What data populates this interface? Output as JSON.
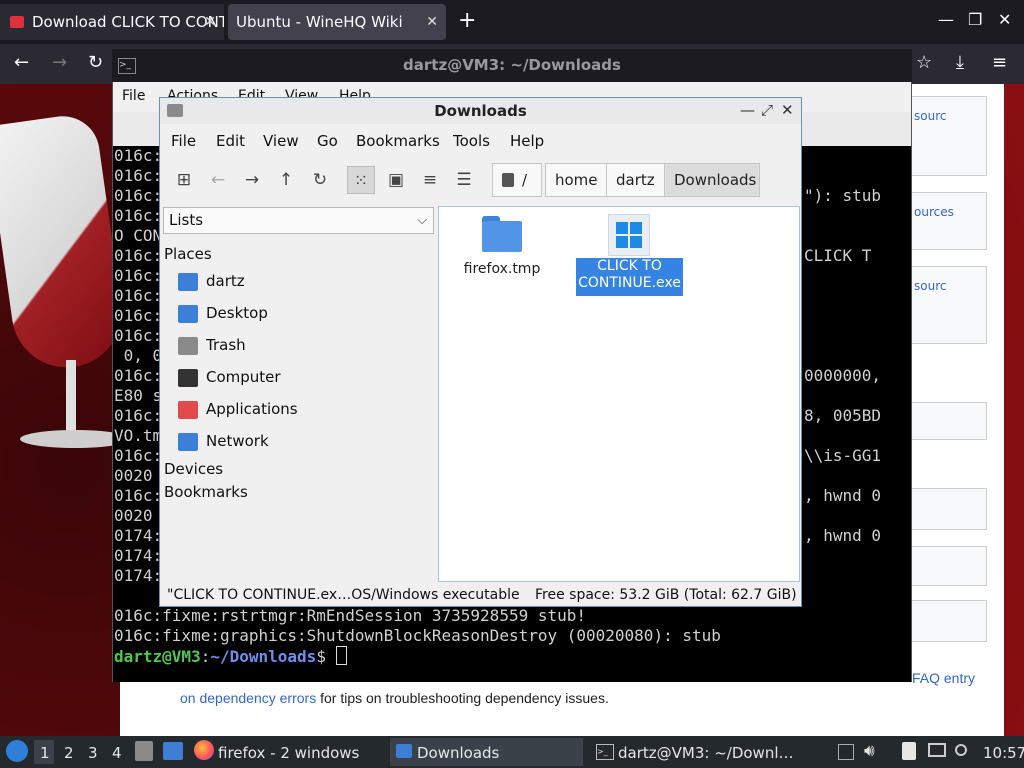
{
  "browser": {
    "tabs": [
      {
        "label": "Download CLICK TO CONTINUE"
      },
      {
        "label": "Ubuntu - WineHQ Wiki"
      }
    ],
    "new_tab": "+",
    "address_title": "dartz@VM3: ~/Downloads"
  },
  "wiki": {
    "side_links": [
      "sourc",
      "ources",
      "sourc"
    ],
    "faq_link": "FAQ entry",
    "bottom_link": "on dependency errors",
    "bottom_text": " for tips on troubleshooting dependency issues."
  },
  "terminal": {
    "menu": [
      "File",
      "Actions",
      "Edit",
      "View",
      "Help"
    ],
    "left_lines": [
      "016c:",
      "016c:",
      "016c:",
      "016c:",
      "O CON",
      "016c:",
      "016c:",
      "016c:",
      "016c:",
      "016c:",
      " 0, 0",
      "016c:",
      "E80 s",
      "016c:",
      "VO.tm",
      "016c:",
      "0020",
      "016c:",
      "0020",
      "0174:",
      "0174:",
      "0174:"
    ],
    "right_lines": [
      {
        "row": 2,
        "text": "\"): stub"
      },
      {
        "row": 5,
        "text": "CLICK T"
      },
      {
        "row": 11,
        "text": "0000000,"
      },
      {
        "row": 13,
        "text": "8, 005BD"
      },
      {
        "row": 15,
        "text": "\\\\is-GG1"
      },
      {
        "row": 17,
        "text": ", hwnd 0"
      },
      {
        "row": 19,
        "text": ", hwnd 0"
      }
    ],
    "bottom_lines": [
      "016c:fixme:rstrtmgr:RmEndSession 3735928559 stub!",
      "016c:fixme:graphics:ShutdownBlockReasonDestroy (00020080): stub"
    ],
    "prompt_user": "dartz@VM3",
    "prompt_sep": ":",
    "prompt_path": "~/Downloads",
    "prompt_sym": "$ "
  },
  "file_manager": {
    "title": "Downloads",
    "menu": [
      "File",
      "Edit",
      "View",
      "Go",
      "Bookmarks",
      "Tools",
      "Help"
    ],
    "breadcrumb": [
      "/",
      "home",
      "dartz",
      "Downloads"
    ],
    "side_view_select": "Lists",
    "places_heading": "Places",
    "places": [
      {
        "label": "dartz",
        "icon": "home-folder-icon",
        "color": "#3d7fd6"
      },
      {
        "label": "Desktop",
        "icon": "desktop-icon",
        "color": "#3d7fd6"
      },
      {
        "label": "Trash",
        "icon": "trash-icon",
        "color": "#8a8a8a"
      },
      {
        "label": "Computer",
        "icon": "computer-icon",
        "color": "#333333"
      },
      {
        "label": "Applications",
        "icon": "applications-icon",
        "color": "#e24b4b"
      },
      {
        "label": "Network",
        "icon": "network-icon",
        "color": "#3d7fd6"
      }
    ],
    "devices_heading": "Devices",
    "bookmarks_heading": "Bookmarks",
    "files": [
      {
        "name": "firefox.tmp",
        "icon": "folder-icon"
      },
      {
        "name": "CLICK TO CONTINUE.exe",
        "icon": "windows-executable-icon",
        "selected": true
      }
    ],
    "status_selected": "\"CLICK TO CONTINUE.ex…OS/Windows executable",
    "status_free": "Free space: 53.2 GiB (Total: 62.7 GiB)",
    "accent": "#3584e4"
  },
  "taskbar": {
    "workspaces": [
      "1",
      "2",
      "3",
      "4"
    ],
    "windows": [
      {
        "label": "firefox - 2 windows"
      },
      {
        "label": "Downloads"
      },
      {
        "label": "dartz@VM3: ~/Downl…"
      }
    ],
    "clock": "10:57"
  }
}
